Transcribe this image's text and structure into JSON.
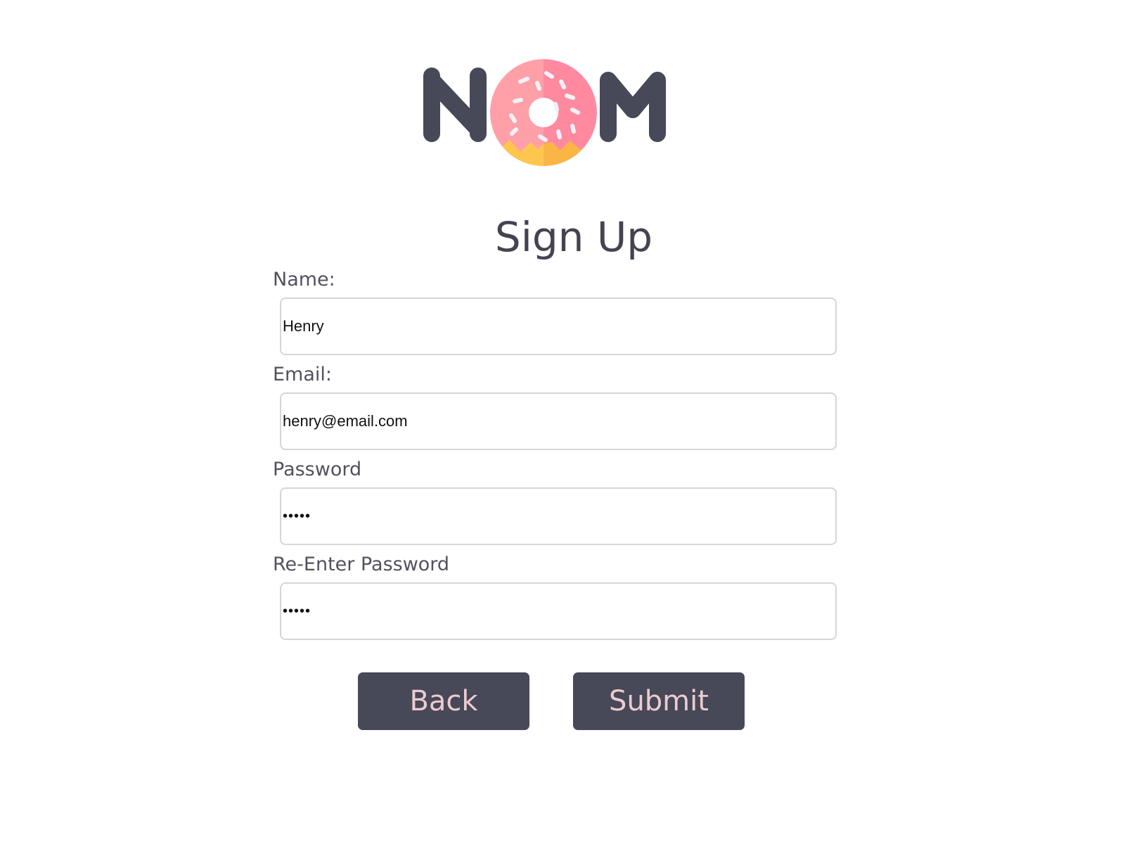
{
  "app": {
    "logo_text": "NOM",
    "colors": {
      "text": "#444451",
      "button_bg": "#474858",
      "button_text": "#eccccf",
      "input_border": "#d6d6d6",
      "donut_pink": "#ffa0a8",
      "donut_pink_dark": "#ff8aa0",
      "donut_dough": "#ffc64f"
    }
  },
  "form": {
    "title": "Sign Up",
    "fields": [
      {
        "label": "Name:",
        "value": "Henry",
        "type": "text"
      },
      {
        "label": "Email:",
        "value": "henry@email.com",
        "type": "email"
      },
      {
        "label": "Password",
        "value": "•••••",
        "type": "password"
      },
      {
        "label": "Re-Enter Password",
        "value": "•••••",
        "type": "password"
      }
    ],
    "buttons": {
      "back": "Back",
      "submit": "Submit"
    }
  }
}
